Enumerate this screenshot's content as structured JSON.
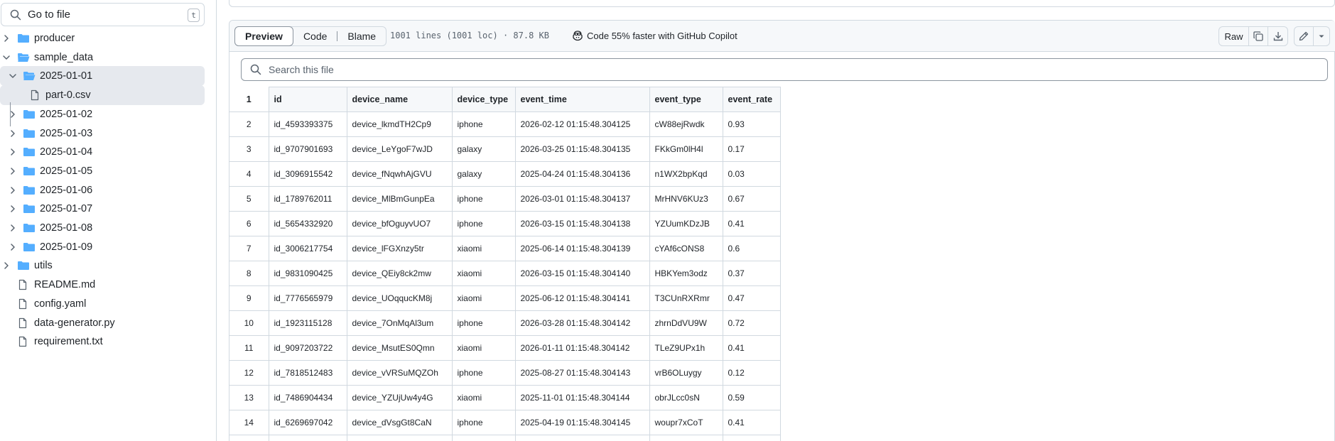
{
  "sidebar": {
    "go_to_file": {
      "placeholder": "Go to file",
      "shortcut": "t"
    },
    "tree": [
      {
        "name": "producer",
        "type": "folder",
        "expanded": false,
        "depth": 0,
        "selected": false
      },
      {
        "name": "sample_data",
        "type": "folder",
        "expanded": true,
        "depth": 0,
        "selected": false
      },
      {
        "name": "2025-01-01",
        "type": "folder",
        "expanded": true,
        "depth": 1,
        "selected": true
      },
      {
        "name": "part-0.csv",
        "type": "file",
        "depth": 2,
        "selected": true
      },
      {
        "name": "2025-01-02",
        "type": "folder",
        "expanded": false,
        "depth": 1,
        "selected": false
      },
      {
        "name": "2025-01-03",
        "type": "folder",
        "expanded": false,
        "depth": 1,
        "selected": false
      },
      {
        "name": "2025-01-04",
        "type": "folder",
        "expanded": false,
        "depth": 1,
        "selected": false
      },
      {
        "name": "2025-01-05",
        "type": "folder",
        "expanded": false,
        "depth": 1,
        "selected": false
      },
      {
        "name": "2025-01-06",
        "type": "folder",
        "expanded": false,
        "depth": 1,
        "selected": false
      },
      {
        "name": "2025-01-07",
        "type": "folder",
        "expanded": false,
        "depth": 1,
        "selected": false
      },
      {
        "name": "2025-01-08",
        "type": "folder",
        "expanded": false,
        "depth": 1,
        "selected": false
      },
      {
        "name": "2025-01-09",
        "type": "folder",
        "expanded": false,
        "depth": 1,
        "selected": false
      },
      {
        "name": "utils",
        "type": "folder",
        "expanded": false,
        "depth": 0,
        "selected": false
      },
      {
        "name": "README.md",
        "type": "file",
        "depth": 0,
        "selected": false
      },
      {
        "name": "config.yaml",
        "type": "file",
        "depth": 0,
        "selected": false
      },
      {
        "name": "data-generator.py",
        "type": "file",
        "depth": 0,
        "selected": false
      },
      {
        "name": "requirement.txt",
        "type": "file",
        "depth": 0,
        "selected": false
      }
    ]
  },
  "file_header": {
    "tabs": [
      "Preview",
      "Code",
      "Blame"
    ],
    "active_tab": "Preview",
    "meta": "1001 lines (1001 loc) · 87.8 KB",
    "copilot": "Code 55% faster with GitHub Copilot",
    "raw_label": "Raw"
  },
  "search": {
    "placeholder": "Search this file"
  },
  "table": {
    "columns": [
      "id",
      "device_name",
      "device_type",
      "event_time",
      "event_type",
      "event_rate"
    ],
    "rows": [
      [
        "id_4593393375",
        "device_lkmdTH2Cp9",
        "iphone",
        "2026-02-12 01:15:48.304125",
        "cW88ejRwdk",
        "0.93"
      ],
      [
        "id_9707901693",
        "device_LeYgoF7wJD",
        "galaxy",
        "2026-03-25 01:15:48.304135",
        "FKkGm0lH4l",
        "0.17"
      ],
      [
        "id_3096915542",
        "device_fNqwhAjGVU",
        "galaxy",
        "2025-04-24 01:15:48.304136",
        "n1WX2bpKqd",
        "0.03"
      ],
      [
        "id_1789762011",
        "device_MlBmGunpEa",
        "iphone",
        "2026-03-01 01:15:48.304137",
        "MrHNV6KUz3",
        "0.67"
      ],
      [
        "id_5654332920",
        "device_bfOguyvUO7",
        "iphone",
        "2026-03-15 01:15:48.304138",
        "YZUumKDzJB",
        "0.41"
      ],
      [
        "id_3006217754",
        "device_lFGXnzy5tr",
        "xiaomi",
        "2025-06-14 01:15:48.304139",
        "cYAf6cONS8",
        "0.6"
      ],
      [
        "id_9831090425",
        "device_QEiy8ck2mw",
        "xiaomi",
        "2026-03-15 01:15:48.304140",
        "HBKYem3odz",
        "0.37"
      ],
      [
        "id_7776565979",
        "device_UOqqucKM8j",
        "xiaomi",
        "2025-06-12 01:15:48.304141",
        "T3CUnRXRmr",
        "0.47"
      ],
      [
        "id_1923115128",
        "device_7OnMqAl3um",
        "iphone",
        "2026-03-28 01:15:48.304142",
        "zhrnDdVU9W",
        "0.72"
      ],
      [
        "id_9097203722",
        "device_MsutES0Qmn",
        "xiaomi",
        "2026-01-11 01:15:48.304142",
        "TLeZ9UPx1h",
        "0.41"
      ],
      [
        "id_7818512483",
        "device_vVRSuMQZOh",
        "iphone",
        "2025-08-27 01:15:48.304143",
        "vrB6OLuygy",
        "0.12"
      ],
      [
        "id_7486904434",
        "device_YZUjUw4y4G",
        "xiaomi",
        "2025-11-01 01:15:48.304144",
        "obrJLcc0sN",
        "0.59"
      ],
      [
        "id_6269697042",
        "device_dVsgGt8CaN",
        "iphone",
        "2025-04-19 01:15:48.304145",
        "woupr7xCoT",
        "0.41"
      ],
      [
        "",
        "",
        "",
        "",
        "",
        ""
      ]
    ]
  },
  "colors": {
    "folder": "#54aeff",
    "border": "#d1d9e0",
    "header_bg": "#f6f8fa",
    "selected_bg": "#e6e9ee"
  }
}
